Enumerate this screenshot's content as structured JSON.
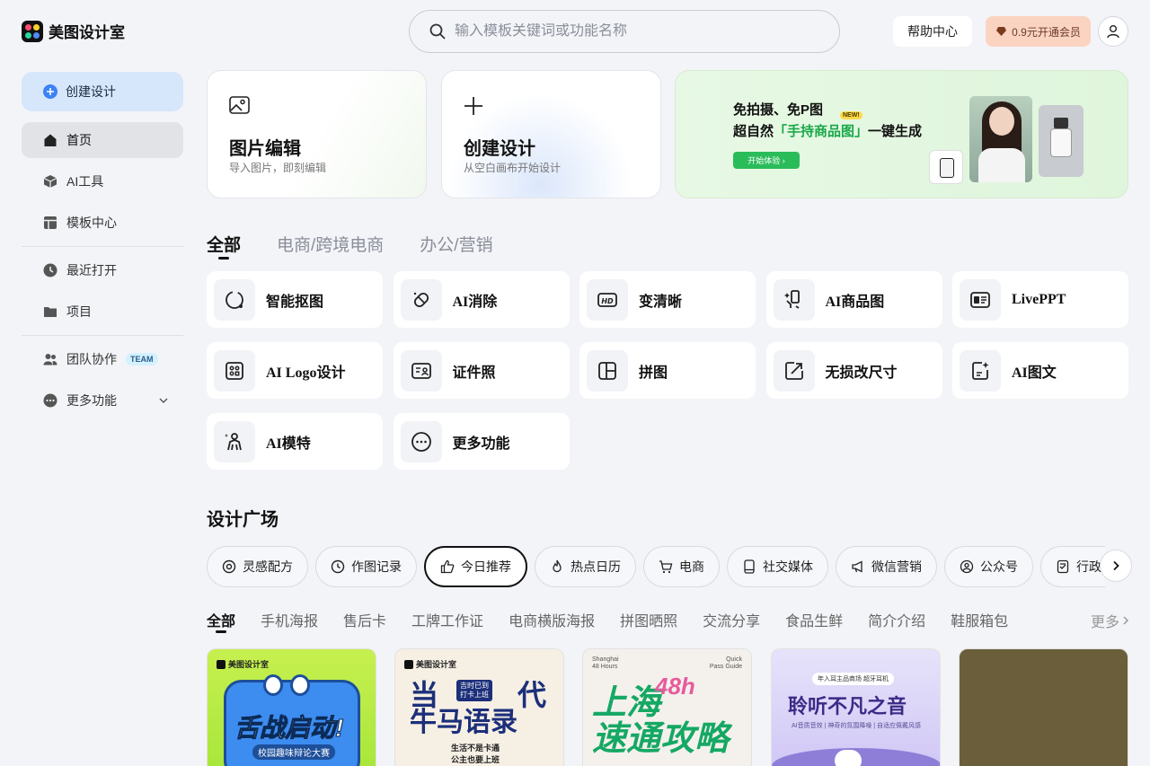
{
  "header": {
    "logo_text": "美图设计室",
    "search_placeholder": "输入模板关键词或功能名称",
    "help_label": "帮助中心",
    "vip_label": "0.9元开通会员"
  },
  "sidebar": {
    "create_label": "创建设计",
    "items": [
      {
        "label": "首页",
        "icon": "home-icon"
      },
      {
        "label": "AI工具",
        "icon": "cube-icon"
      },
      {
        "label": "模板中心",
        "icon": "template-icon"
      },
      {
        "label": "最近打开",
        "icon": "clock-icon"
      },
      {
        "label": "项目",
        "icon": "folder-icon"
      },
      {
        "label": "团队协作",
        "icon": "team-icon",
        "badge": "TEAM"
      },
      {
        "label": "更多功能",
        "icon": "more-icon"
      }
    ]
  },
  "cards": [
    {
      "title": "图片编辑",
      "subtitle": "导入图片，即刻编辑"
    },
    {
      "title": "创建设计",
      "subtitle": "从空白画布开始设计"
    }
  ],
  "banner": {
    "line1": "免拍摄、免P图",
    "line2_pre": "超自然",
    "line2_highlight": "「手持商品图」",
    "line2_post": "一键生成",
    "new_tag": "NEW!",
    "button": "开始体验 ›"
  },
  "category_tabs": [
    "全部",
    "电商/跨境电商",
    "办公/营销"
  ],
  "tools": [
    {
      "label": "智能抠图",
      "icon": "cutout-icon"
    },
    {
      "label": "AI消除",
      "icon": "eraser-icon"
    },
    {
      "label": "变清晰",
      "icon": "hd-icon"
    },
    {
      "label": "AI商品图",
      "icon": "product-hand-icon"
    },
    {
      "label": "LivePPT",
      "icon": "ppt-icon"
    },
    {
      "label": "AI Logo设计",
      "icon": "logo-design-icon"
    },
    {
      "label": "证件照",
      "icon": "id-photo-icon"
    },
    {
      "label": "拼图",
      "icon": "collage-icon"
    },
    {
      "label": "无损改尺寸",
      "icon": "resize-icon"
    },
    {
      "label": "AI图文",
      "icon": "ai-text-image-icon"
    },
    {
      "label": "AI模特",
      "icon": "ai-model-icon"
    },
    {
      "label": "更多功能",
      "icon": "more-dots-icon"
    }
  ],
  "design_square": {
    "title": "设计广场",
    "chips": [
      {
        "label": "灵感配方",
        "icon": "inspiration-icon"
      },
      {
        "label": "作图记录",
        "icon": "history-icon"
      },
      {
        "label": "今日推荐",
        "icon": "thumbs-up-icon"
      },
      {
        "label": "热点日历",
        "icon": "flame-icon"
      },
      {
        "label": "电商",
        "icon": "cart-icon"
      },
      {
        "label": "社交媒体",
        "icon": "phone-icon"
      },
      {
        "label": "微信营销",
        "icon": "megaphone-icon"
      },
      {
        "label": "公众号",
        "icon": "account-icon"
      },
      {
        "label": "行政办公",
        "icon": "document-icon"
      }
    ],
    "subtabs": [
      "全部",
      "手机海报",
      "售后卡",
      "工牌工作证",
      "电商横版海报",
      "拼图晒照",
      "交流分享",
      "食品生鲜",
      "简介介绍",
      "鞋服箱包"
    ],
    "more_label": "更多"
  },
  "templates": [
    {
      "brand": "美图设计室",
      "title": "舌战启动!",
      "subtitle": "校园趣味辩论大赛"
    },
    {
      "brand": "美图设计室",
      "line1": "当",
      "line1b": "代",
      "line2": "牛马语录",
      "tag": "吉时已到\n打卡上班",
      "small": "生活不是卡通\n公主也要上班"
    },
    {
      "corner_left": "Shanghai\n48 Hours",
      "corner_right": "Quick\nPass Guide",
      "num": "48h",
      "title": "上海\n速通攻略"
    },
    {
      "pill": "年入耳主品商场  超牙耳机",
      "title": "聆听不凡之音",
      "subtitle": "AI音质音效 | 神奇的氛围降噪 | 自适应佩戴风感"
    },
    {}
  ],
  "colors": {
    "accent_blue": "#3b82f6",
    "banner_green": "#2bbc5a",
    "vip_bg": "#fbd3c1"
  }
}
